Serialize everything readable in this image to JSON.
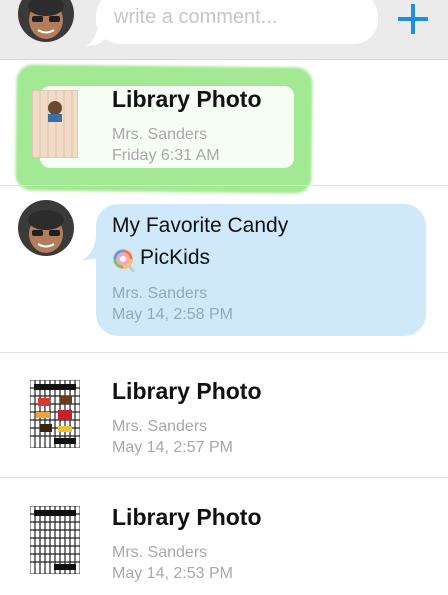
{
  "compose": {
    "placeholder": "write a comment...",
    "add_icon": "plus-icon",
    "accent": "#1a8fe3"
  },
  "feed": [
    {
      "kind": "photo",
      "title": "Library Photo",
      "author": "Mrs. Sanders",
      "time": "Friday 6:31 AM",
      "thumbnail": "library-photo-portrait",
      "highlighted": true
    },
    {
      "kind": "comment",
      "text_line1": "My Favorite Candy",
      "text_emoji": "lollipop-icon",
      "text_line2": "PicKids",
      "author": "Mrs. Sanders",
      "time": "May 14, 2:58 PM"
    },
    {
      "kind": "photo",
      "title": "Library Photo",
      "author": "Mrs. Sanders",
      "time": "May 14, 2:57 PM",
      "thumbnail": "candy-poster-thumbnail"
    },
    {
      "kind": "photo",
      "title": "Library Photo",
      "author": "Mrs. Sanders",
      "time": "May 14, 2:53 PM",
      "thumbnail": "pattern-poster-thumbnail"
    }
  ],
  "colors": {
    "bubble": "#cfe9fb",
    "highlight": "#80e06a"
  }
}
